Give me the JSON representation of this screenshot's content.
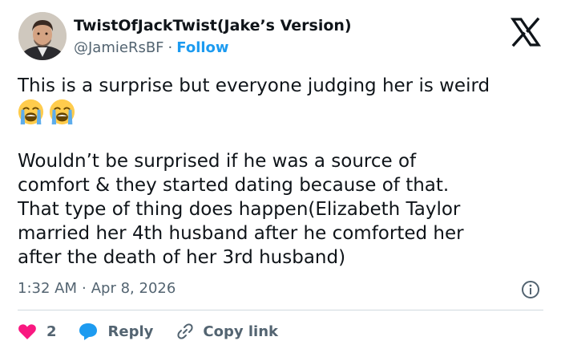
{
  "author": {
    "display_name": "TwistOfJackTwist(Jake’s Version)",
    "handle": "@JamieRsBF",
    "separator": "·",
    "follow_label": "Follow"
  },
  "tweet": {
    "lines": [
      "This is a surprise but everyone judging her is weird",
      "Wouldn’t be surprised if he was a source of",
      "comfort & they started dating because of that.",
      "That type of thing does happen(Elizabeth Taylor",
      "married her 4th husband after he comforted her",
      "after the death of her 3rd husband)"
    ],
    "emojis": [
      "loudly-crying-face-emoji",
      "loudly-crying-face-emoji"
    ]
  },
  "meta": {
    "time": "1:32 AM",
    "separator": "·",
    "date": "Apr 8, 2026"
  },
  "actions": {
    "like_count": "2",
    "reply_label": "Reply",
    "copy_label": "Copy link"
  },
  "colors": {
    "text": "#0f1419",
    "secondary": "#536471",
    "accent": "#1d9bf0",
    "like": "#f91880",
    "divider": "#cfd9de"
  },
  "icons": [
    "x-logo-icon",
    "info-icon",
    "heart-icon",
    "reply-bubble-icon",
    "link-icon"
  ]
}
